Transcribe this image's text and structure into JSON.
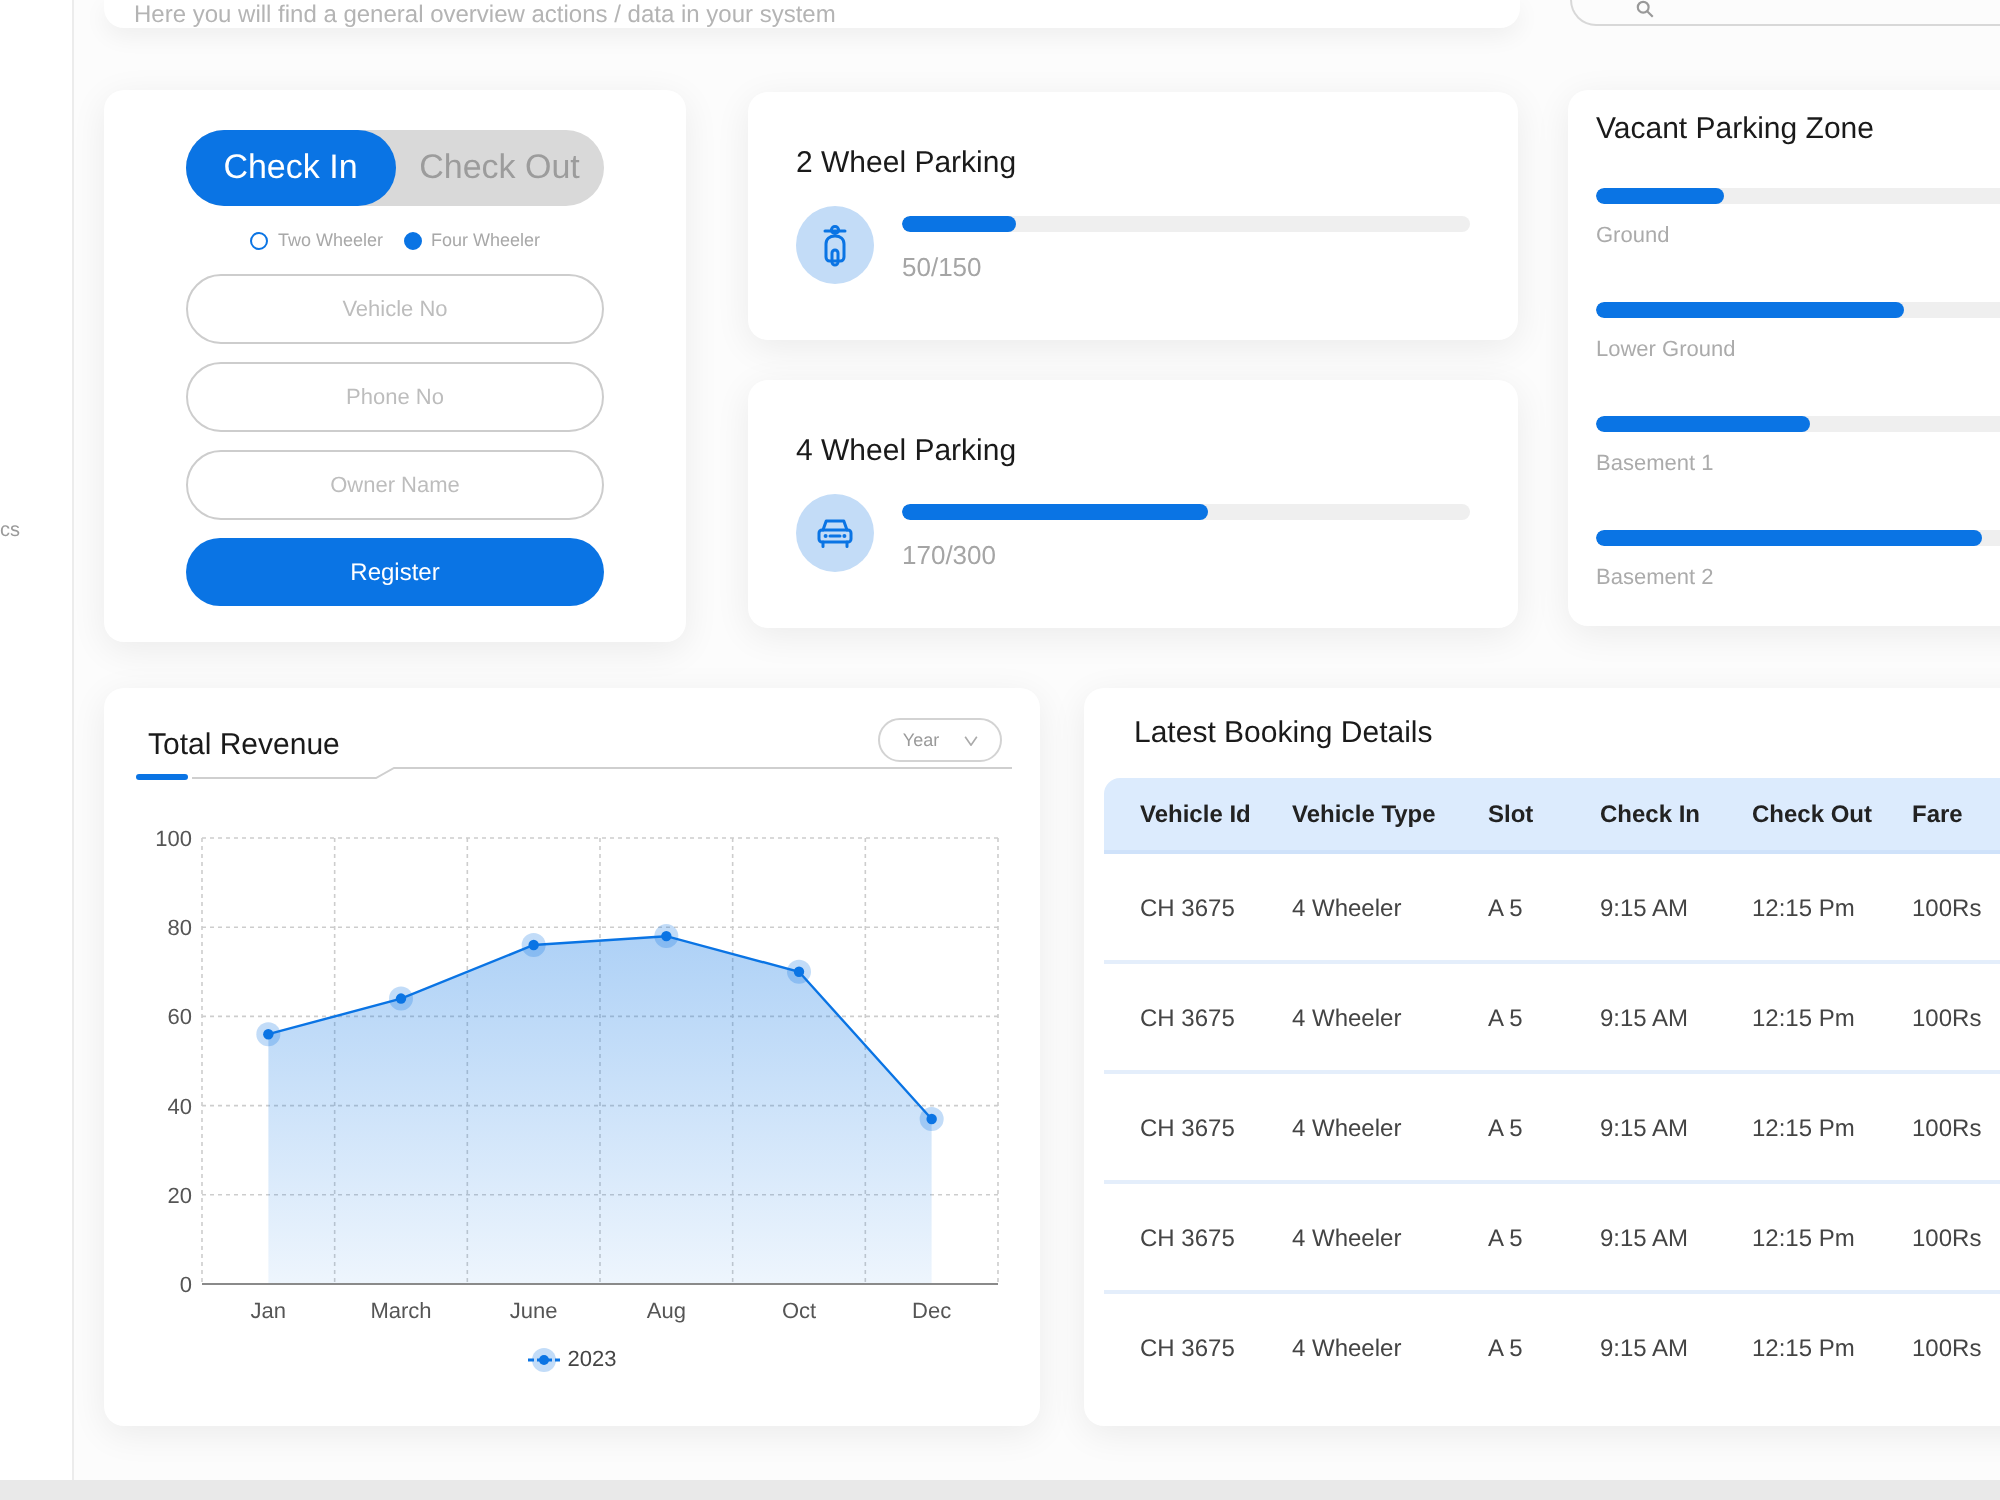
{
  "header": {
    "subtitle": "Here you will find a general overview actions / data in your system"
  },
  "sidebar": {
    "items": [
      {
        "label": "cs"
      }
    ]
  },
  "check_form": {
    "tabs": [
      {
        "label": "Check In",
        "selected": true
      },
      {
        "label": "Check Out",
        "selected": false
      }
    ],
    "vehicle_types": [
      {
        "label": "Two Wheeler",
        "selected": false
      },
      {
        "label": "Four Wheeler",
        "selected": true
      }
    ],
    "fields": [
      {
        "placeholder": "Vehicle No"
      },
      {
        "placeholder": "Phone No"
      },
      {
        "placeholder": "Owner Name"
      }
    ],
    "submit": "Register"
  },
  "parking_cards": [
    {
      "title": "2 Wheel Parking",
      "level": 0.2,
      "reading": "50/150"
    },
    {
      "title": "4 Wheel Parking",
      "level": 0.54,
      "reading": "170/300"
    }
  ],
  "vacant_zones": {
    "title": "Vacant Parking Zone",
    "zones": [
      {
        "label": "Ground",
        "level": 0.18
      },
      {
        "label": "Lower Ground",
        "level": 0.43
      },
      {
        "label": "Basement 1",
        "level": 0.3
      },
      {
        "label": "Basement 2",
        "level": 0.54
      }
    ]
  },
  "revenue": {
    "title": "Total Revenue",
    "period": "Year",
    "chart_data": [
      {
        "type": "area",
        "categories": [
          "Jan",
          "March",
          "June",
          "Aug",
          "Oct",
          "Dec"
        ],
        "series": [
          {
            "name": "2023",
            "color": "#0a74e4",
            "values": [
              56,
              64,
              76,
              78,
              70,
              37
            ]
          }
        ],
        "ylim": [
          0,
          100
        ],
        "yticks": [
          0,
          20,
          40,
          60,
          80,
          100
        ],
        "grid": true,
        "marker": "circle",
        "legend": "bottom"
      }
    ]
  },
  "bookings": {
    "title": "Latest Booking Details",
    "columns": [
      "Vehicle Id",
      "Vehicle Type",
      "Slot",
      "Check In",
      "Check Out",
      "Fare"
    ],
    "rows": [
      [
        "CH 3675",
        "4 Wheeler",
        "A 5",
        "9:15 AM",
        "12:15 Pm",
        "100Rs"
      ],
      [
        "CH 3675",
        "4 Wheeler",
        "A 5",
        "9:15 AM",
        "12:15 Pm",
        "100Rs"
      ],
      [
        "CH 3675",
        "4 Wheeler",
        "A 5",
        "9:15 AM",
        "12:15 Pm",
        "100Rs"
      ],
      [
        "CH 3675",
        "4 Wheeler",
        "A 5",
        "9:15 AM",
        "12:15 Pm",
        "100Rs"
      ],
      [
        "CH 3675",
        "4 Wheeler",
        "A 5",
        "9:15 AM",
        "12:15 Pm",
        "100Rs"
      ]
    ]
  }
}
